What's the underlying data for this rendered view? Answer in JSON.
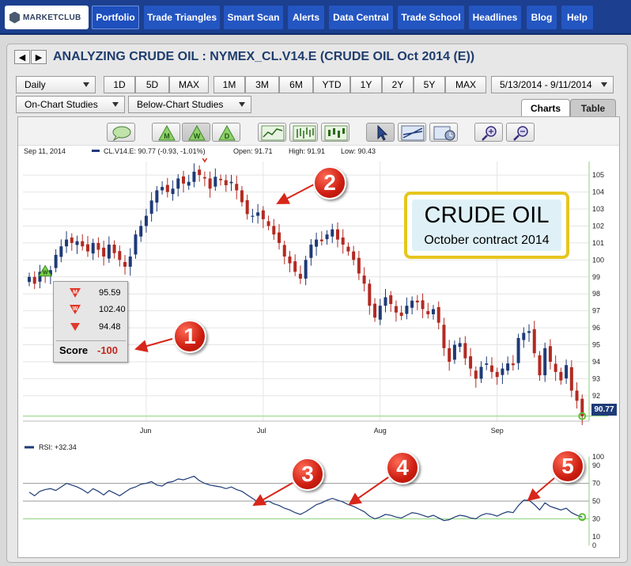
{
  "nav": {
    "logo": "MARKETCLUB",
    "items": [
      "Portfolio",
      "Trade Triangles",
      "Smart Scan",
      "Alerts",
      "Data Central",
      "Trade School",
      "Headlines",
      "Blog",
      "Help"
    ],
    "active": "Portfolio"
  },
  "window": {
    "title": "ANALYZING CRUDE OIL : NYMEX_CL.V14.E (CRUDE OIL Oct 2014 (E))",
    "back_icon": "left-arrow-icon",
    "forward_icon": "right-arrow-icon"
  },
  "controls": {
    "interval": "Daily",
    "ranges_short": [
      "1D",
      "5D",
      "MAX"
    ],
    "ranges_long": [
      "1M",
      "3M",
      "6M",
      "YTD",
      "1Y",
      "2Y",
      "5Y",
      "MAX"
    ],
    "date_range": "5/13/2014 - 9/11/2014",
    "on_chart_studies": "On-Chart Studies",
    "below_chart_studies": "Below-Chart Studies",
    "tab_charts": "Charts",
    "tab_table": "Table"
  },
  "toolbar_icons": [
    "chat-icon",
    "monthly-triangle-icon",
    "weekly-triangle-icon",
    "daily-triangle-icon",
    "line-chart-icon",
    "ohlc-bars-icon",
    "candlestick-icon",
    "pointer-icon",
    "trendline-icon",
    "chart-settings-icon",
    "zoom-in-icon",
    "zoom-out-icon"
  ],
  "info": {
    "date": "Sep 11, 2014",
    "symbol_line": "CL.V14.E: 90.77 (-0.93, -1.01%)",
    "open": "Open: 91.71",
    "high": "High: 91.91",
    "low": "Low: 90.43"
  },
  "price_tag": "90.77",
  "score_box": {
    "rows": [
      {
        "icon": "monthly-down-triangle-icon",
        "letter": "M",
        "value": "95.59"
      },
      {
        "icon": "weekly-down-triangle-icon",
        "letter": "W",
        "value": "102.40"
      },
      {
        "icon": "daily-down-triangle-icon",
        "letter": "",
        "value": "94.48"
      }
    ],
    "score_label": "Score",
    "score_value": "-100"
  },
  "callout": {
    "title": "CRUDE OIL",
    "subtitle": "October contract 2014"
  },
  "badges": [
    "1",
    "2",
    "3",
    "4",
    "5"
  ],
  "rsi_label": "RSI: +32.34",
  "colors": {
    "nav_bg": "#1c3f8f",
    "up_candle": "#1e3b77",
    "down_candle": "#b32a22",
    "rsi_line": "#1e3b77",
    "callout_border": "#e6c61f",
    "badge_red": "#cc1d10",
    "green_signal": "#5cbf3a"
  },
  "chart_data": {
    "type": "candlestick",
    "x_ticks": [
      "Jun",
      "Jul",
      "Aug",
      "Sep"
    ],
    "y_ticks": [
      92,
      93,
      94,
      95,
      96,
      97,
      98,
      99,
      100,
      101,
      102,
      103,
      104,
      105
    ],
    "ylim": [
      90.5,
      105.8
    ],
    "grid": true,
    "signals": [
      {
        "label": "W",
        "type": "weekly-up",
        "index": 3
      },
      {
        "label": "W",
        "type": "weekly-down",
        "index": 33
      }
    ],
    "close": [
      99.0,
      98.6,
      99.3,
      99.1,
      99.4,
      100.3,
      100.8,
      101.2,
      101.0,
      101.1,
      100.8,
      100.5,
      101.0,
      100.6,
      100.2,
      100.9,
      100.4,
      100.0,
      99.6,
      100.2,
      101.5,
      102.0,
      102.6,
      103.5,
      104.1,
      104.3,
      104.0,
      104.2,
      104.8,
      104.5,
      104.6,
      105.2,
      105.0,
      104.8,
      104.2,
      104.9,
      104.7,
      104.4,
      104.6,
      104.1,
      103.4,
      102.7,
      102.6,
      102.8,
      102.4,
      102.0,
      101.5,
      101.0,
      100.2,
      99.8,
      99.3,
      98.9,
      100.0,
      100.9,
      101.2,
      101.1,
      101.5,
      101.8,
      101.2,
      100.9,
      100.5,
      100.0,
      99.2,
      98.6,
      97.3,
      96.6,
      97.3,
      97.8,
      97.4,
      96.9,
      96.7,
      97.3,
      97.6,
      97.5,
      97.1,
      96.8,
      97.1,
      96.3,
      94.8,
      94.0,
      95.0,
      95.1,
      94.2,
      93.6,
      93.0,
      93.7,
      93.9,
      93.4,
      93.1,
      93.6,
      93.9,
      93.8,
      95.4,
      95.7,
      95.8,
      94.5,
      93.2,
      94.8,
      94.0,
      93.4,
      92.9,
      93.8,
      92.3,
      91.7,
      90.8
    ],
    "rsi": {
      "label": "RSI: +32.34",
      "y_ticks": [
        0,
        10,
        30,
        50,
        70,
        90,
        100
      ],
      "levels": [
        30,
        50,
        70
      ],
      "ylim": [
        0,
        100
      ],
      "values": [
        60,
        56,
        61,
        63,
        64,
        62,
        66,
        70,
        68,
        66,
        63,
        59,
        64,
        61,
        57,
        62,
        59,
        56,
        60,
        64,
        66,
        69,
        70,
        72,
        68,
        67,
        71,
        72,
        75,
        74,
        76,
        78,
        73,
        70,
        68,
        67,
        66,
        64,
        66,
        63,
        61,
        57,
        53,
        49,
        48,
        50,
        47,
        45,
        42,
        40,
        37,
        35,
        38,
        42,
        46,
        48,
        51,
        53,
        51,
        49,
        46,
        44,
        41,
        38,
        33,
        30,
        32,
        35,
        34,
        32,
        31,
        34,
        37,
        36,
        34,
        32,
        34,
        31,
        28,
        29,
        32,
        34,
        33,
        31,
        30,
        34,
        36,
        35,
        33,
        36,
        38,
        37,
        45,
        51,
        51,
        46,
        40,
        48,
        44,
        42,
        40,
        42,
        37,
        34,
        32
      ]
    }
  }
}
